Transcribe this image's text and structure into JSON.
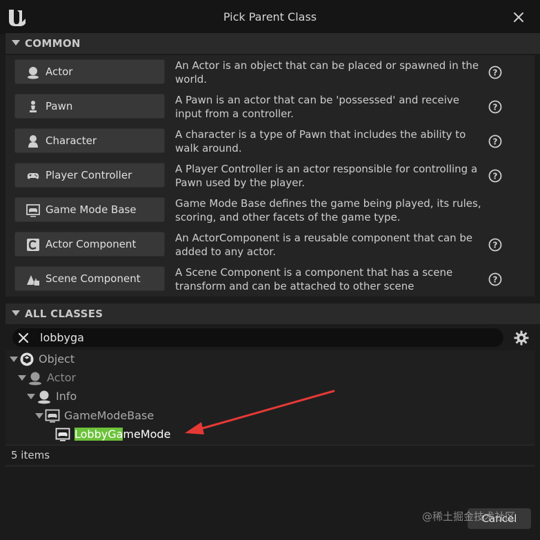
{
  "window": {
    "title": "Pick Parent Class",
    "close_icon": "close-icon",
    "logo": "unreal-logo-icon"
  },
  "common": {
    "header": "COMMON",
    "items": [
      {
        "label": "Actor",
        "icon": "actor-icon",
        "description": "An Actor is an object that can be placed or spawned in the world.",
        "help": true
      },
      {
        "label": "Pawn",
        "icon": "pawn-icon",
        "description": "A Pawn is an actor that can be 'possessed' and receive input from a controller.",
        "help": true
      },
      {
        "label": "Character",
        "icon": "character-icon",
        "description": "A character is a type of Pawn that includes the ability to walk around.",
        "help": true
      },
      {
        "label": "Player Controller",
        "icon": "gamepad-icon",
        "description": "A Player Controller is an actor responsible for controlling a Pawn used by the player.",
        "help": true
      },
      {
        "label": "Game Mode Base",
        "icon": "game-mode-icon",
        "description": "Game Mode Base defines the game being played, its rules, scoring, and other facets of the game type.",
        "help": false
      },
      {
        "label": "Actor Component",
        "icon": "component-icon",
        "description": "An ActorComponent is a reusable component that can be added to any actor.",
        "help": true
      },
      {
        "label": "Scene Component",
        "icon": "scene-component-icon",
        "description": "A Scene Component is a component that has a scene transform and can be attached to other scene",
        "help": true
      }
    ]
  },
  "all_classes": {
    "header": "ALL CLASSES",
    "search": {
      "value": "lobbyga"
    },
    "tree": [
      {
        "label": "Object",
        "icon": "object-icon",
        "expanded": true
      },
      {
        "label": "Actor",
        "icon": "actor-icon",
        "expanded": true
      },
      {
        "label": "Info",
        "icon": "actor-icon",
        "expanded": true
      },
      {
        "label": "GameModeBase",
        "icon": "game-mode-icon",
        "expanded": true
      },
      {
        "label_match": "LobbyGa",
        "label_rest": "meMode",
        "icon": "game-mode-icon",
        "expanded": false
      }
    ],
    "item_count": "5 items"
  },
  "footer": {
    "cancel_label": "Cancel",
    "watermark": "@稀土掘金技术社区"
  },
  "colors": {
    "background": "#1b1b1b",
    "highlight": "#6cc23a",
    "annotation_arrow": "#e53935"
  }
}
